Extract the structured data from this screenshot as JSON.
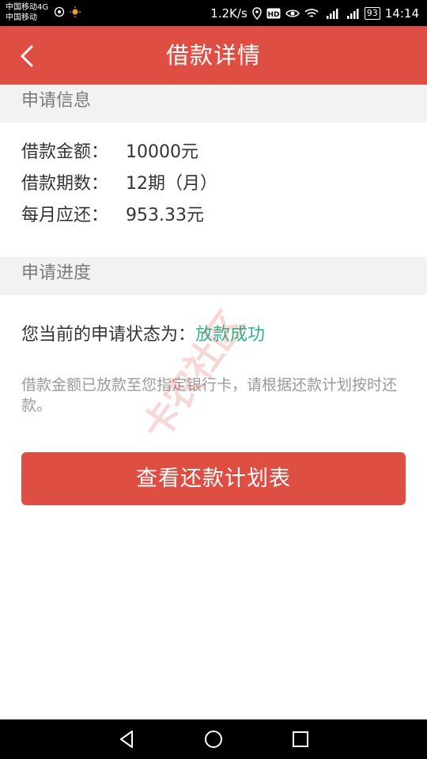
{
  "status_bar": {
    "carrier_line1": "中国移动4G",
    "carrier_line2": "中国移动",
    "speed": "1.2K/s",
    "battery": "93",
    "time": "14:14"
  },
  "header": {
    "title": "借款详情"
  },
  "apply_info": {
    "section_title": "申请信息",
    "rows": [
      {
        "label": "借款金额：",
        "value": "10000元"
      },
      {
        "label": "借款期数：",
        "value": "12期（月）"
      },
      {
        "label": "每月应还：",
        "value": "953.33元"
      }
    ]
  },
  "progress": {
    "section_title": "申请进度",
    "status_label": "您当前的申请状态为：",
    "status_value": "放款成功",
    "notice": "借款金额已放款至您指定银行卡，请根据还款计划按时还款。"
  },
  "actions": {
    "plan_button": "查看还款计划表"
  },
  "watermark": "卡农社区",
  "colors": {
    "primary": "#df4e43",
    "success": "#2bb58c",
    "section_bg": "#f2f2f2"
  },
  "icons": {
    "back": "chevron-left-icon",
    "nav": [
      "back-triangle-icon",
      "home-circle-icon",
      "recents-square-icon"
    ]
  }
}
